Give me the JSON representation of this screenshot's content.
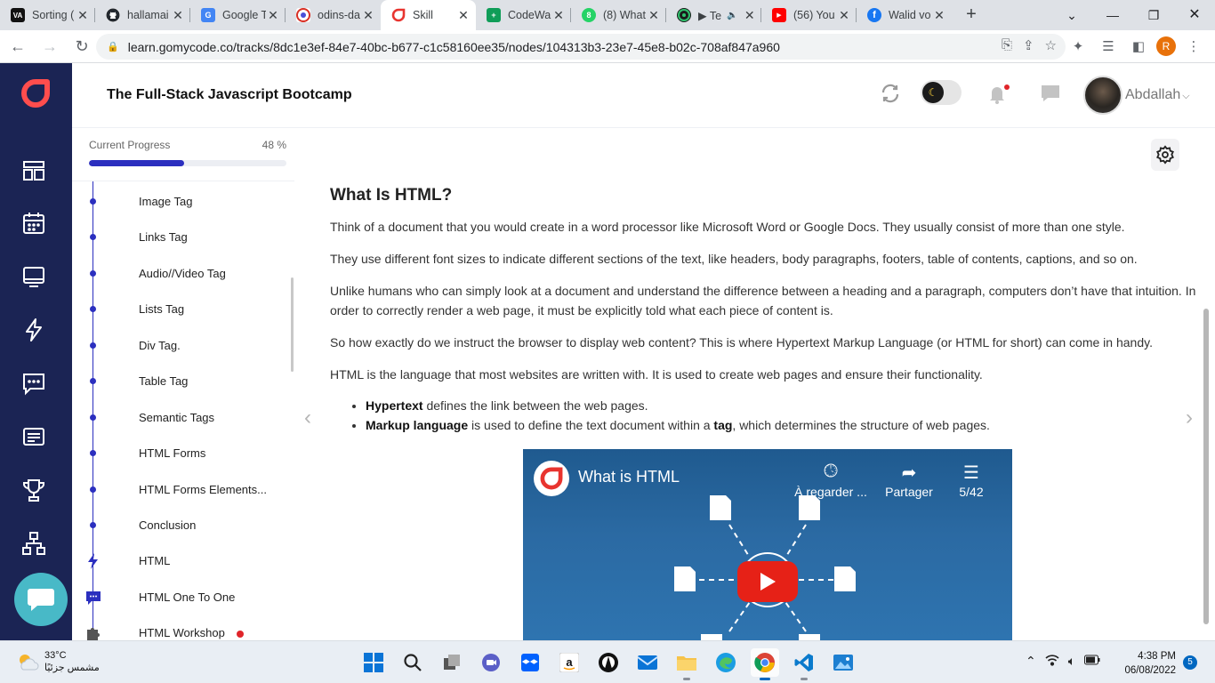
{
  "browser": {
    "tabs": [
      {
        "title": "Sorting (",
        "favicon": "visualgo-icon",
        "color": "#111111",
        "glyph": "VA"
      },
      {
        "title": "hallamai",
        "favicon": "github-icon",
        "color": "#24292f",
        "glyph": ""
      },
      {
        "title": "Google T",
        "favicon": "google-translate-icon",
        "color": "#4285f4",
        "glyph": "G"
      },
      {
        "title": "odins-da",
        "favicon": "codepen-icon",
        "color": "#4a4fd8",
        "glyph": ""
      },
      {
        "title": "Skill",
        "favicon": "gomycode-icon",
        "color": "#e8342f",
        "glyph": ""
      },
      {
        "title": "CodeWa",
        "favicon": "sheets-icon",
        "color": "#0f9d58",
        "glyph": "+"
      },
      {
        "title": "(8) What",
        "favicon": "whatsapp-icon",
        "color": "#25d366",
        "glyph": "8"
      },
      {
        "title": "▶ Te",
        "favicon": "media-icon",
        "color": "#1b1b1b",
        "glyph": "",
        "muted": "🔈"
      },
      {
        "title": "(56) You",
        "favicon": "youtube-icon",
        "color": "#ff0000",
        "glyph": "▶"
      },
      {
        "title": "Walid vo",
        "favicon": "facebook-icon",
        "color": "#1877f2",
        "glyph": "f"
      }
    ],
    "url": "learn.gomycode.co/tracks/8dc1e3ef-84e7-40bc-b677-c1c58160ee35/nodes/104313b3-23e7-45e8-b02c-708af847a960",
    "profile_initial": "R"
  },
  "header": {
    "course_title": "The Full-Stack Javascript Bootcamp",
    "username": "Abdallah"
  },
  "progress": {
    "label": "Current Progress",
    "value_text": "48 %",
    "percent": 48
  },
  "lessons": [
    {
      "label": "Image Tag",
      "kind": "dot"
    },
    {
      "label": "Links Tag",
      "kind": "dot"
    },
    {
      "label": "Audio//Video Tag",
      "kind": "dot"
    },
    {
      "label": "Lists Tag",
      "kind": "dot"
    },
    {
      "label": "Div Tag.",
      "kind": "dot"
    },
    {
      "label": "Table Tag",
      "kind": "dot"
    },
    {
      "label": "Semantic Tags",
      "kind": "dot"
    },
    {
      "label": "HTML Forms",
      "kind": "dot"
    },
    {
      "label": "HTML Forms Elements...",
      "kind": "dot"
    },
    {
      "label": "Conclusion",
      "kind": "dot"
    },
    {
      "label": "HTML",
      "kind": "lightning-icon"
    },
    {
      "label": "HTML One To One",
      "kind": "chat-icon"
    },
    {
      "label": "HTML Workshop",
      "kind": "puzzle-icon",
      "badge": true
    }
  ],
  "content": {
    "title": "What Is HTML?",
    "paragraphs": [
      "Think of a document that you would create in a word processor like Microsoft Word or Google Docs. They usually consist of more than one style.",
      "They use different font sizes to indicate different sections of the text, like headers, body paragraphs, footers, table of contents, captions, and so on.",
      "Unlike humans who can simply look at a document and understand the difference between a heading and a paragraph, computers don’t have that intuition. In order to correctly render a web page, it must be explicitly told what each piece of content is.",
      "So how exactly do we instruct the browser to display web content? This is where Hypertext Markup Language (or HTML for short) can come in handy.",
      "HTML is the language that most websites are written with. It is used to create web pages and ensure their functionality."
    ],
    "bullets": [
      {
        "term": "Hypertext",
        "text": " defines the link between the web pages."
      },
      {
        "term": "Markup language",
        "text_a": " is used to define the text document within a ",
        "bold": "tag",
        "text_b": ", which determines the structure of web pages."
      }
    ]
  },
  "video": {
    "title": "What is HTML",
    "watch_later": "À regarder ...",
    "share": "Partager",
    "playlist": "5/42"
  },
  "taskbar": {
    "temperature": "33°C",
    "weather_text": "مشمس جزئيًا",
    "time": "4:38 PM",
    "date": "06/08/2022",
    "notifications": "5"
  }
}
